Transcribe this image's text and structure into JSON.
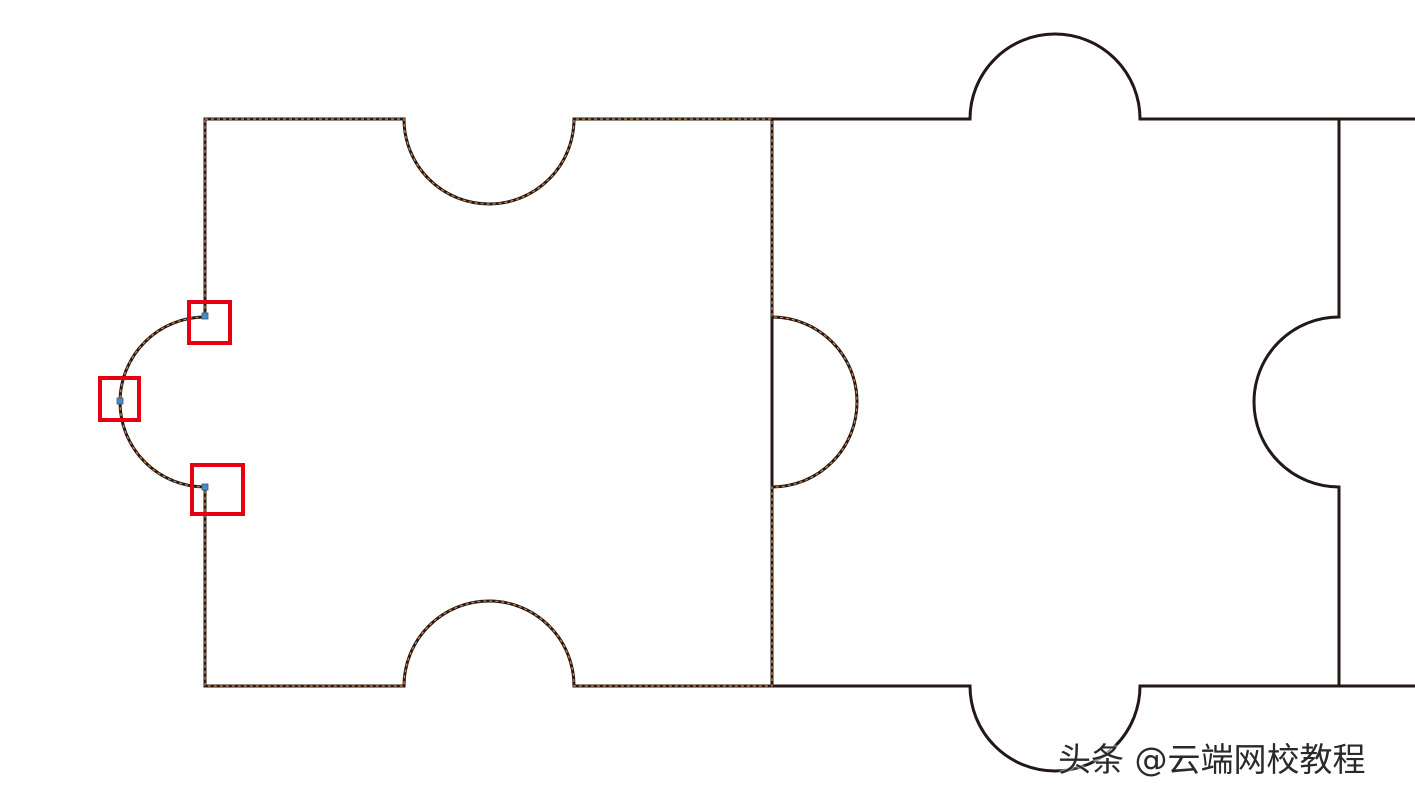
{
  "colors": {
    "outline": "#231815",
    "selection_dash": "#d98a4a",
    "highlight_box": "#e60012",
    "node_handle": "#3b8fd6",
    "background": "#ffffff"
  },
  "watermark": {
    "text": "头条 @云端网校教程"
  }
}
